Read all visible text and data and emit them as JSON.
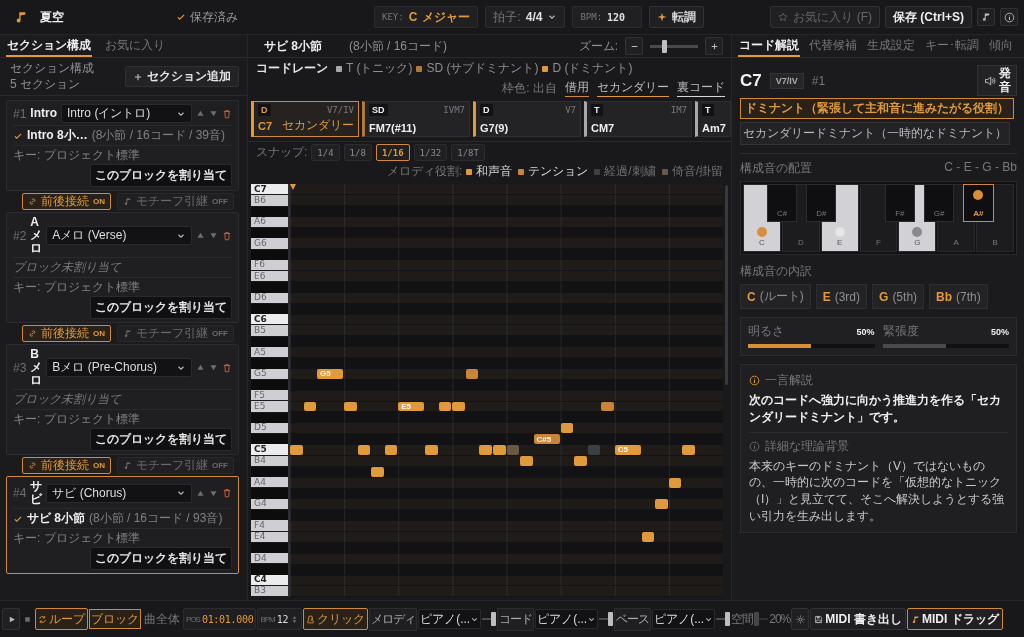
{
  "app": {
    "title": "夏空",
    "save_status": "保存済み"
  },
  "toolbar": {
    "key": {
      "label": "KEY:",
      "value": "C",
      "mode": "メジャー"
    },
    "meter": {
      "label": "拍子:",
      "value": "4/4"
    },
    "bpm": {
      "label": "BPM:",
      "value": "120"
    },
    "transpose": "転調",
    "favorite": {
      "label": "お気に入り (F)",
      "disabled": true
    },
    "save": "保存 (Ctrl+S)"
  },
  "left_panel": {
    "tabs": [
      {
        "label": "セクション構成",
        "selected": true
      },
      {
        "label": "お気に入り",
        "selected": false
      }
    ],
    "header": {
      "title": "セクション構成",
      "count": "5 セクション"
    },
    "add_button": "セクション追加",
    "sections": [
      {
        "number": "#1",
        "name": "Intro",
        "type": "Intro (イントロ)",
        "selected": false,
        "block": {
          "title": "Intro 8小…",
          "stats": "(8小節 / 16コード / 39音)"
        },
        "key": "キー: プロジェクト標準",
        "assign": "このブロックを割り当て",
        "link": {
          "connect": {
            "label": "前後接続",
            "state": "ON",
            "on": true
          },
          "motif": {
            "label": "モチーフ引継",
            "state": "OFF",
            "on": false
          }
        }
      },
      {
        "number": "#2",
        "name": "Aメロ",
        "type": "Aメロ (Verse)",
        "selected": false,
        "unassigned": "ブロック未割り当て",
        "key": "キー: プロジェクト標準",
        "assign": "このブロックを割り当て",
        "link": {
          "connect": {
            "label": "前後接続",
            "state": "ON",
            "on": true
          },
          "motif": {
            "label": "モチーフ引継",
            "state": "OFF",
            "on": false
          }
        }
      },
      {
        "number": "#3",
        "name": "Bメロ",
        "type": "Bメロ (Pre-Chorus)",
        "selected": false,
        "unassigned": "ブロック未割り当て",
        "key": "キー: プロジェクト標準",
        "assign": "このブロックを割り当て",
        "link": {
          "connect": {
            "label": "前後接続",
            "state": "ON",
            "on": true
          },
          "motif": {
            "label": "モチーフ引継",
            "state": "OFF",
            "on": false
          }
        }
      },
      {
        "number": "#4",
        "name": "サビ",
        "type": "サビ (Chorus)",
        "selected": true,
        "block": {
          "title": "サビ 8小節",
          "stats": "(8小節 / 16コード / 93音)"
        },
        "key": "キー: プロジェクト標準",
        "assign": "このブロックを割り当て"
      }
    ]
  },
  "center": {
    "title": "サビ 8小節",
    "subtitle": "(8小節 / 16コード)",
    "zoom": {
      "label": "ズーム:",
      "level": 0.3
    },
    "chord_lane": {
      "title": "コードレーン",
      "legend": [
        {
          "label": "T (トニック)",
          "color": "#a8a8a8"
        },
        {
          "label": "SD (サブドミナント)",
          "color": "#b07a3a"
        },
        {
          "label": "D (ドミナント)",
          "color": "#e09a3c"
        }
      ],
      "frame_legend": {
        "label": "枠色: 出自",
        "items": [
          {
            "label": "借用",
            "color": "#c98a3a"
          },
          {
            "label": "セカンダリー",
            "color": "#e09a3c"
          },
          {
            "label": "裏コード",
            "color": "#d8d8d8"
          }
        ]
      }
    },
    "chords": [
      {
        "function": "D",
        "roman": "V7/IV",
        "name": "C7",
        "origin": "セカンダリー",
        "selected": true
      },
      {
        "function": "SD",
        "roman": "IVM7",
        "name": "FM7(#11)",
        "selected": false
      },
      {
        "function": "D",
        "roman": "V7",
        "name": "G7(9)",
        "selected": false
      },
      {
        "function": "T",
        "roman": "IM7",
        "name": "CM7",
        "selected": false
      },
      {
        "function": "T",
        "name": "Am7",
        "selected": false
      }
    ],
    "snap": {
      "label": "スナップ:",
      "options": [
        {
          "label": "1/4",
          "selected": false
        },
        {
          "label": "1/8",
          "selected": false
        },
        {
          "label": "1/16",
          "selected": true
        },
        {
          "label": "1/32",
          "selected": false
        },
        {
          "label": "1/8T",
          "selected": false
        }
      ]
    },
    "roles": {
      "label": "メロディ役割:",
      "items": [
        {
          "label": "和声音",
          "kind": "chord"
        },
        {
          "label": "テンション",
          "kind": "tension"
        },
        {
          "label": "経過/刺繍",
          "kind": "passing"
        },
        {
          "label": "倚音/掛留",
          "kind": "appoggiatura"
        }
      ]
    },
    "piano_roll": {
      "keys": [
        {
          "label": "C7",
          "kind": "c"
        },
        {
          "label": "B6",
          "kind": "white"
        },
        {
          "kind": "black"
        },
        {
          "label": "A6",
          "kind": "white"
        },
        {
          "kind": "black"
        },
        {
          "label": "G6",
          "kind": "white"
        },
        {
          "kind": "black"
        },
        {
          "label": "F6",
          "kind": "white"
        },
        {
          "label": "E6",
          "kind": "white"
        },
        {
          "kind": "black"
        },
        {
          "label": "D6",
          "kind": "white"
        },
        {
          "kind": "black"
        },
        {
          "label": "C6",
          "kind": "c"
        },
        {
          "label": "B5",
          "kind": "white"
        },
        {
          "kind": "black"
        },
        {
          "label": "A5",
          "kind": "white"
        },
        {
          "kind": "black"
        },
        {
          "label": "G5",
          "kind": "white",
          "notes": [
            {
              "label": "G5",
              "kind": "chord"
            },
            {
              "kind": "tension"
            }
          ]
        },
        {
          "kind": "black"
        },
        {
          "label": "F5",
          "kind": "white"
        },
        {
          "label": "E5",
          "kind": "white",
          "notes": [
            {
              "kind": "chord"
            },
            {
              "kind": "chord"
            },
            {
              "label": "E5",
              "kind": "chord"
            },
            {
              "kind": "chord"
            },
            {
              "kind": "chord"
            },
            {
              "kind": "tension"
            }
          ]
        },
        {
          "kind": "black"
        },
        {
          "label": "D5",
          "kind": "white",
          "notes": [
            {
              "kind": "chord"
            }
          ]
        },
        {
          "kind": "black",
          "notes": [
            {
              "label": "C#5",
              "kind": "tension"
            }
          ]
        },
        {
          "label": "C5",
          "kind": "c",
          "notes": [
            {
              "kind": "chord"
            },
            {
              "kind": "chord"
            },
            {
              "kind": "chord"
            },
            {
              "kind": "chord"
            },
            {
              "kind": "chord"
            },
            {
              "kind": "chord"
            },
            {
              "kind": "appoggiatura"
            },
            {
              "kind": "passing"
            },
            {
              "label": "C5",
              "kind": "chord"
            },
            {
              "kind": "chord"
            }
          ]
        },
        {
          "label": "B4",
          "kind": "white",
          "notes": [
            {
              "kind": "chord"
            },
            {
              "kind": "chord"
            }
          ]
        },
        {
          "kind": "black",
          "notes": [
            {
              "kind": "chord"
            }
          ]
        },
        {
          "label": "A4",
          "kind": "white",
          "notes": [
            {
              "kind": "chord"
            }
          ]
        },
        {
          "kind": "black"
        },
        {
          "label": "G4",
          "kind": "white",
          "notes": [
            {
              "kind": "chord"
            }
          ]
        },
        {
          "kind": "black"
        },
        {
          "label": "F4",
          "kind": "white"
        },
        {
          "label": "E4",
          "kind": "white",
          "notes": [
            {
              "kind": "chord"
            }
          ]
        },
        {
          "kind": "black"
        },
        {
          "label": "D4",
          "kind": "white"
        },
        {
          "kind": "black"
        },
        {
          "label": "C4",
          "kind": "c"
        },
        {
          "label": "B3",
          "kind": "white"
        }
      ]
    }
  },
  "right_panel": {
    "tabs": [
      {
        "label": "コード解説",
        "selected": true
      },
      {
        "label": "代替候補",
        "selected": false
      },
      {
        "label": "生成設定",
        "selected": false
      },
      {
        "label": "キー･転調",
        "selected": false
      },
      {
        "label": "傾向",
        "selected": false
      }
    ],
    "chord": {
      "name": "C7",
      "roman": "V7/IV",
      "index": "#1"
    },
    "play_button": "発音",
    "tags": [
      {
        "label": "ドミナント（緊張して主和音に進みたがる役割）",
        "kind": "function"
      },
      {
        "label": "セカンダリードミナント（一時的なドミナント）",
        "kind": "plain"
      }
    ],
    "voicing": {
      "title": "構成音の配置",
      "notes": "C - E - G - Bb",
      "keys": [
        {
          "label": "C",
          "kind": "white",
          "on": true,
          "color": "#d98e3a"
        },
        {
          "label": "D",
          "kind": "white",
          "on": false
        },
        {
          "label": "E",
          "kind": "white",
          "on": true,
          "color": "#e6e6e6"
        },
        {
          "label": "F",
          "kind": "white",
          "on": false
        },
        {
          "label": "G",
          "kind": "white",
          "on": true,
          "color": "#8a8a8e"
        },
        {
          "label": "A",
          "kind": "white",
          "on": false
        },
        {
          "label": "B",
          "kind": "white",
          "on": false
        },
        {
          "label": "C#",
          "kind": "black",
          "on": false
        },
        {
          "label": "D#",
          "kind": "black",
          "on": false
        },
        {
          "label": "F#",
          "kind": "black",
          "on": false
        },
        {
          "label": "G#",
          "kind": "black",
          "on": false
        },
        {
          "label": "A#",
          "kind": "black",
          "on": true,
          "color": "#d98e3a"
        }
      ]
    },
    "components": {
      "title": "構成音の内訳",
      "items": [
        {
          "note": "C",
          "role": "(ルート)"
        },
        {
          "note": "E",
          "role": "(3rd)"
        },
        {
          "note": "G",
          "role": "(5th)"
        },
        {
          "note": "Bb",
          "role": "(7th)"
        }
      ]
    },
    "meters": [
      {
        "label": "明るさ",
        "reading": "50%",
        "level": 0.5,
        "kind": "accent"
      },
      {
        "label": "緊張度",
        "reading": "50%",
        "level": 0.5,
        "kind": "neutral"
      }
    ],
    "explanation": {
      "summary_title": "一言解説",
      "summary": "次のコードへ強力に向かう推進力を作る「セカンダリードミナント」です。",
      "detail_title": "詳細な理論背景",
      "detail": "本来のキーのドミナント（V）ではないものの、一時的に次のコードを「仮想的なトニック（I）」と見立てて、そこへ解決しようとする強い引力を生み出します。"
    }
  },
  "transport": {
    "loop": {
      "label": "ループ",
      "on": true
    },
    "range": [
      {
        "label": "ブロック",
        "selected": true
      },
      {
        "label": "曲全体",
        "selected": false
      }
    ],
    "position": {
      "label": "POS",
      "value": "01:01.000"
    },
    "bpm": {
      "label": "BPM",
      "value": "12"
    },
    "click": {
      "label": "クリック",
      "on": true
    },
    "mixer": [
      {
        "kind": "channel",
        "label": "メロディ",
        "instrument": "ピアノ(...",
        "level": 0.85
      },
      {
        "kind": "channel",
        "label": "コード",
        "instrument": "ピアノ(...",
        "level": 0.85
      },
      {
        "kind": "channel",
        "label": "ベース",
        "instrument": "ピアノ(...",
        "level": 0.85
      },
      {
        "kind": "effect",
        "label": "空間",
        "reading": "20%",
        "level": 0.2
      }
    ],
    "export": "MIDI 書き出し",
    "drag": "MIDI ドラッグ"
  }
}
